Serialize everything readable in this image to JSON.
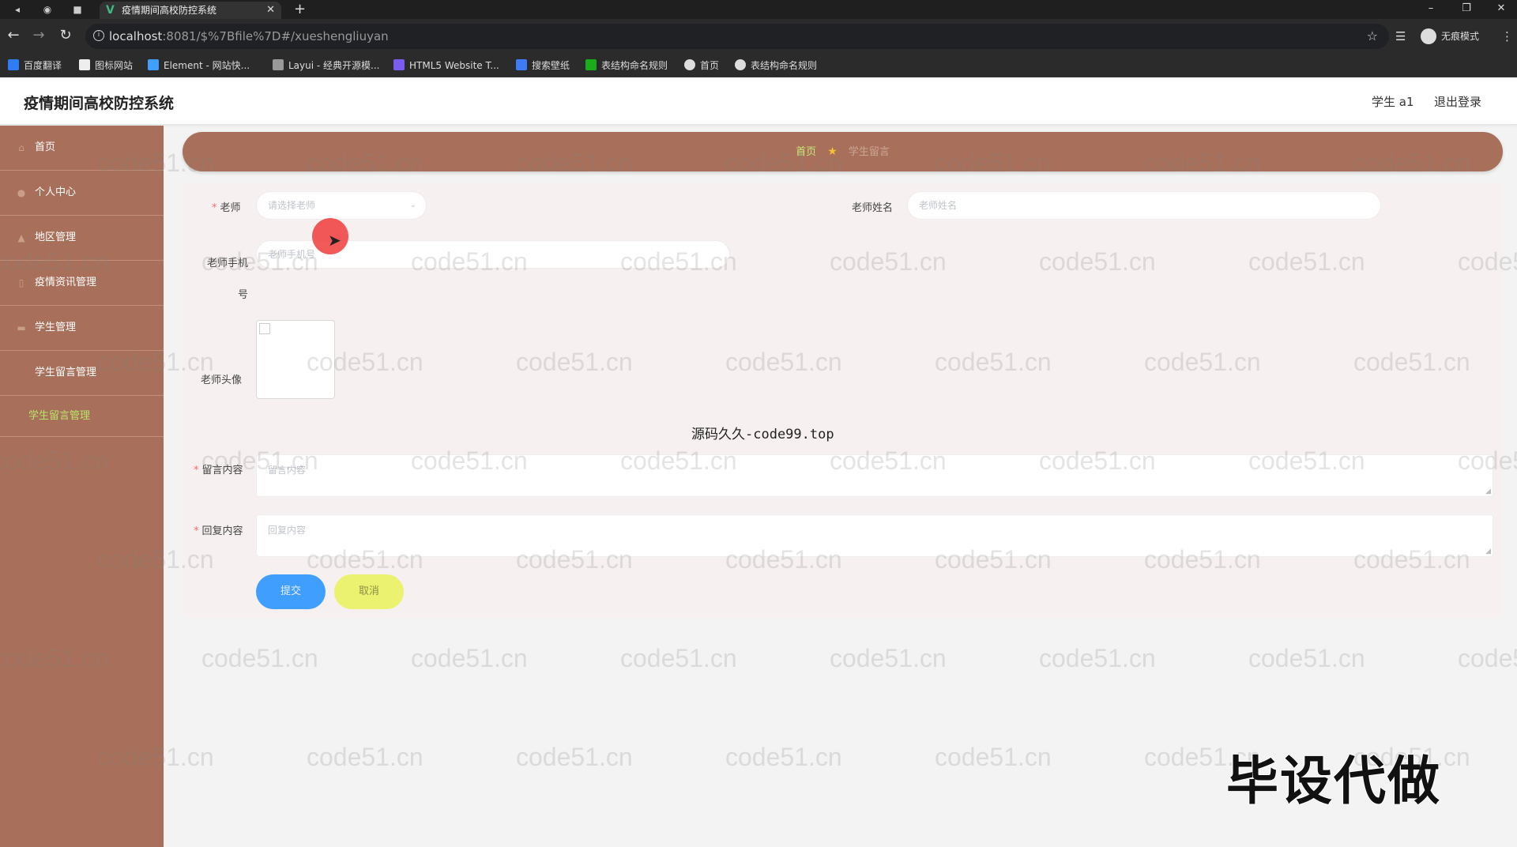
{
  "browser": {
    "tab_title": "疫情期间高校防控系统",
    "url_host": "localhost",
    "url_rest": ":8081/$%7Bfile%7D#/xueshengliuyan",
    "incognito_label": "无痕模式",
    "bookmarks": [
      {
        "label": "百度翻译",
        "color": "#2f7cf6"
      },
      {
        "label": "图标网站",
        "color": "#ffffff"
      },
      {
        "label": "Element - 网站快...",
        "color": "#409eff"
      },
      {
        "label": "Layui - 经典开源模...",
        "color": "#999999"
      },
      {
        "label": "HTML5 Website T...",
        "color": "#7a5cf0"
      },
      {
        "label": "搜索壁纸",
        "color": "#3d7bf7"
      },
      {
        "label": "表结构命名规则",
        "color": "#1aad19"
      },
      {
        "label": "首页",
        "color": "#dddddd"
      },
      {
        "label": "表结构命名规则",
        "color": "#dddddd"
      }
    ]
  },
  "header": {
    "title": "疫情期间高校防控系统",
    "user": "学生 a1",
    "logout": "退出登录"
  },
  "sidebar": {
    "items": [
      {
        "label": "首页",
        "icon": "home-icon"
      },
      {
        "label": "个人中心",
        "icon": "user-icon"
      },
      {
        "label": "地区管理",
        "icon": "map-icon"
      },
      {
        "label": "疫情资讯管理",
        "icon": "info-icon"
      },
      {
        "label": "学生管理",
        "icon": "list-icon"
      },
      {
        "label": "学生留言管理",
        "icon": "message-icon"
      }
    ],
    "sub_item": "学生留言管理"
  },
  "breadcrumb": {
    "home": "首页",
    "current": "学生留言"
  },
  "form": {
    "teacher_label": "老师",
    "teacher_placeholder": "请选择老师",
    "teacher_name_label": "老师姓名",
    "teacher_name_placeholder": "老师姓名",
    "teacher_phone_label": "老师手机号",
    "teacher_phone_placeholder": "老师手机号",
    "teacher_avatar_label": "老师头像",
    "message_label": "留言内容",
    "message_placeholder": "留言内容",
    "reply_label": "回复内容",
    "reply_placeholder": "回复内容",
    "submit": "提交",
    "cancel": "取消"
  },
  "overlay": {
    "caption": "源码久久-code99.top",
    "watermark_text": "code51.cn",
    "stamp": "毕设代做"
  },
  "colors": {
    "sidebar_bg": "#a8705a",
    "accent_green": "#b9e46a",
    "submit_blue": "#409eff",
    "cancel_yellow": "#eaf26f"
  }
}
